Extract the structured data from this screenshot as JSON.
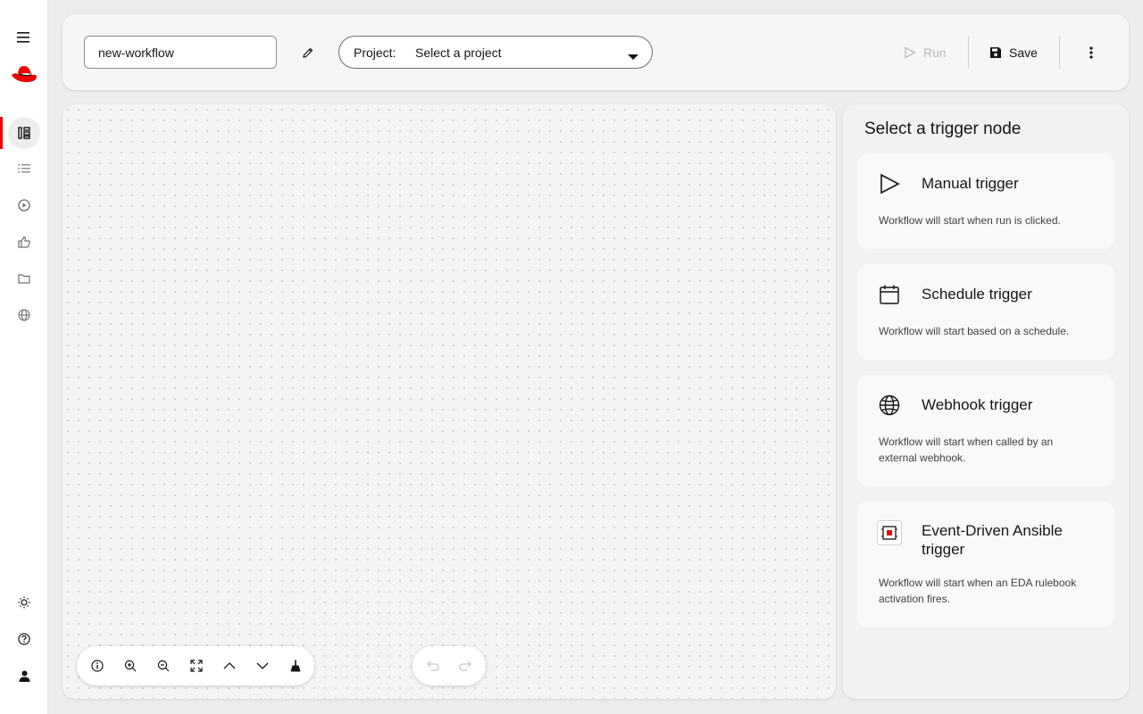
{
  "rail": {
    "icons": [
      "menu-icon",
      "redhat-logo",
      "workflow-icon",
      "list-icon",
      "play-circle-icon",
      "thumbs-up-icon",
      "folder-icon",
      "globe-icon",
      "sun-icon",
      "help-icon",
      "user-icon"
    ]
  },
  "toolbar": {
    "workflow_name": "new-workflow",
    "project_label": "Project:",
    "project_value": "Select a project",
    "run_label": "Run",
    "save_label": "Save",
    "run_disabled": true
  },
  "panel": {
    "title": "Select a trigger node",
    "triggers": [
      {
        "icon": "play-outline-icon",
        "title": "Manual trigger",
        "description": "Workflow will start when run is clicked."
      },
      {
        "icon": "calendar-icon",
        "title": "Schedule trigger",
        "description": "Workflow will start based on a schedule."
      },
      {
        "icon": "globe-icon",
        "title": "Webhook trigger",
        "description": "Workflow will start when called by an external webhook."
      },
      {
        "icon": "eda-icon",
        "title": "Event-Driven Ansible trigger",
        "description": "Workflow will start when an EDA rulebook activation fires."
      }
    ]
  },
  "canvas_controls": [
    "info-icon",
    "zoom-in-icon",
    "zoom-out-icon",
    "fit-view-icon",
    "chevron-up-icon",
    "chevron-down-icon",
    "clean-layout-icon"
  ],
  "history_controls": [
    "undo-icon",
    "redo-icon"
  ],
  "colors": {
    "brand": "#ee0000",
    "disabled": "#b8bbbe",
    "text": "#151515"
  }
}
